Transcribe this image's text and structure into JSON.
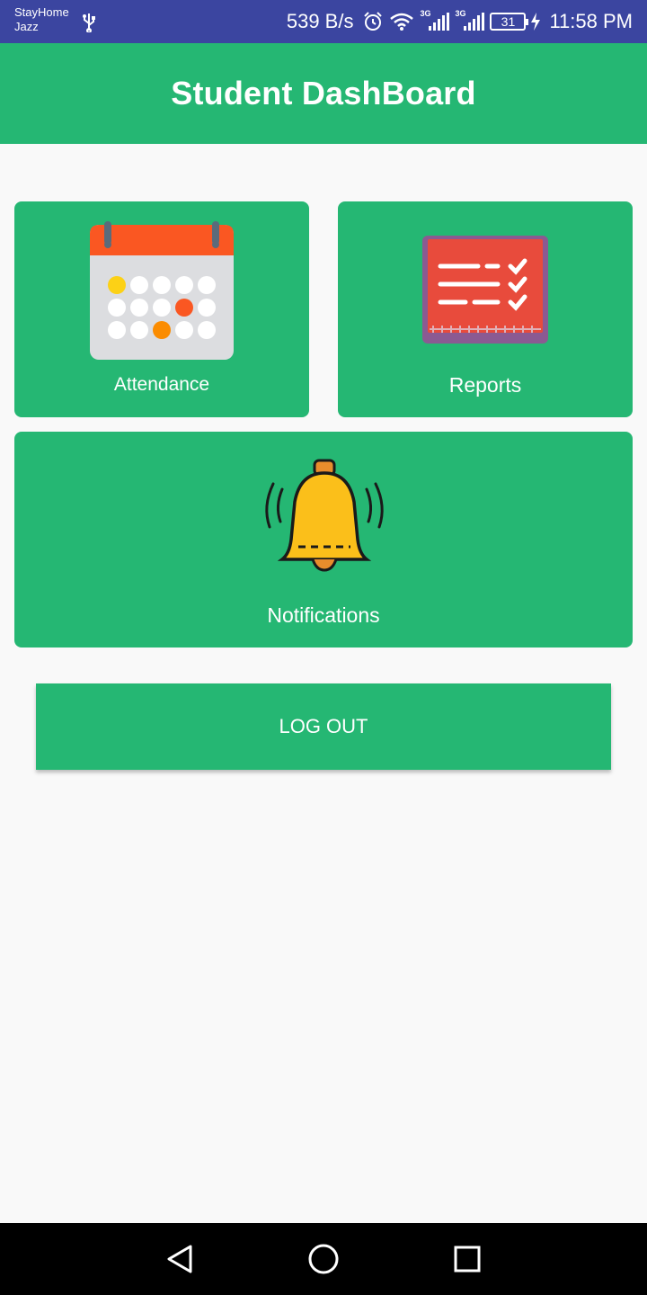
{
  "status_bar": {
    "carrier_line1": "StayHome",
    "carrier_line2": "Jazz",
    "net_speed": "539 B/s",
    "signal1_label": "3G",
    "signal2_label": "3G",
    "battery": "31",
    "time": "11:58 PM"
  },
  "app_bar": {
    "title": "Student DashBoard"
  },
  "cards": {
    "attendance": {
      "label": "Attendance",
      "icon": "calendar-icon"
    },
    "reports": {
      "label": "Reports",
      "icon": "checklist-report-icon"
    },
    "notifications": {
      "label": "Notifications",
      "icon": "bell-icon"
    }
  },
  "logout": {
    "label": "LOG OUT"
  },
  "colors": {
    "status_bar": "#3b45a0",
    "primary": "#25b773",
    "background": "#f9f9f9",
    "nav_bar": "#000000"
  },
  "nav": {
    "back": "back-icon",
    "home": "home-icon",
    "recents": "recents-icon"
  }
}
